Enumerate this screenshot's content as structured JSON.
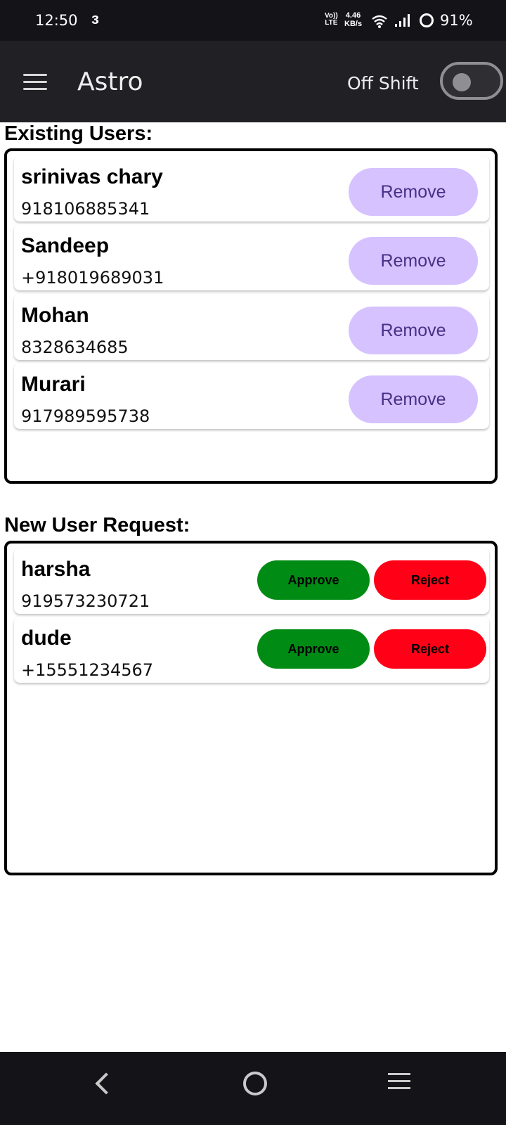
{
  "status_bar": {
    "time": "12:50",
    "carrier_icon": "k-icon",
    "volte_top": "Vo))",
    "volte_bottom": "LTE",
    "speed_value": "4.46",
    "speed_unit": "KB/s",
    "battery": "91%"
  },
  "app_bar": {
    "title": "Astro",
    "shift_label": "Off Shift",
    "shift_on": false
  },
  "existing_users": {
    "title": "Existing Users:",
    "remove_label": "Remove",
    "users": [
      {
        "name": "srinivas chary",
        "phone": "918106885341"
      },
      {
        "name": "Sandeep",
        "phone": "+918019689031"
      },
      {
        "name": "Mohan",
        "phone": "8328634685"
      },
      {
        "name": "Murari",
        "phone": "917989595738"
      }
    ]
  },
  "new_requests": {
    "title": "New User Request:",
    "approve_label": "Approve",
    "reject_label": "Reject",
    "requests": [
      {
        "name": "harsha",
        "phone": "919573230721"
      },
      {
        "name": "dude",
        "phone": "+15551234567"
      }
    ]
  },
  "colors": {
    "remove_button": "#d5c2ff",
    "approve_button": "#008c14",
    "reject_button": "#ff0016",
    "app_bar": "#212025"
  }
}
